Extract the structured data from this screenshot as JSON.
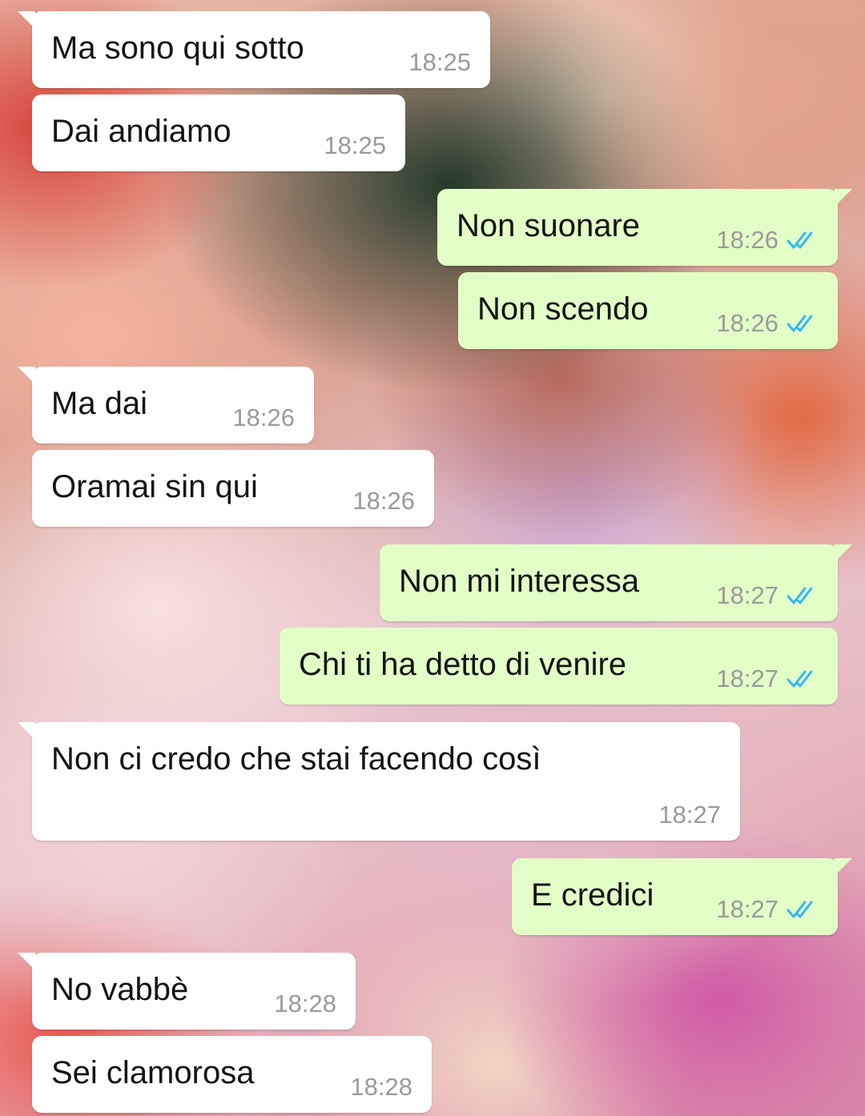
{
  "messages": [
    {
      "text": "Ma sono qui sotto",
      "time": "18:25",
      "direction": "in",
      "status": ""
    },
    {
      "text": "Dai andiamo",
      "time": "18:25",
      "direction": "in",
      "status": ""
    },
    {
      "text": "Non suonare",
      "time": "18:26",
      "direction": "out",
      "status": "read"
    },
    {
      "text": "Non scendo",
      "time": "18:26",
      "direction": "out",
      "status": "read"
    },
    {
      "text": "Ma dai",
      "time": "18:26",
      "direction": "in",
      "status": ""
    },
    {
      "text": "Oramai sin qui",
      "time": "18:26",
      "direction": "in",
      "status": ""
    },
    {
      "text": "Non mi interessa",
      "time": "18:27",
      "direction": "out",
      "status": "read"
    },
    {
      "text": "Chi ti ha detto di venire",
      "time": "18:27",
      "direction": "out",
      "status": "read"
    },
    {
      "text": "Non ci credo che stai facendo così",
      "time": "18:27",
      "direction": "in",
      "status": ""
    },
    {
      "text": "E credici",
      "time": "18:27",
      "direction": "out",
      "status": "read"
    },
    {
      "text": "No vabbè",
      "time": "18:28",
      "direction": "in",
      "status": ""
    },
    {
      "text": "Sei clamorosa",
      "time": "18:28",
      "direction": "in",
      "status": ""
    }
  ],
  "colors": {
    "incoming_bubble": "#ffffff",
    "outgoing_bubble": "#e2ffc7",
    "read_tick": "#34b7f1",
    "timestamp": "#9a9a9a"
  },
  "icons": {
    "read_receipt": "double-check-icon"
  }
}
